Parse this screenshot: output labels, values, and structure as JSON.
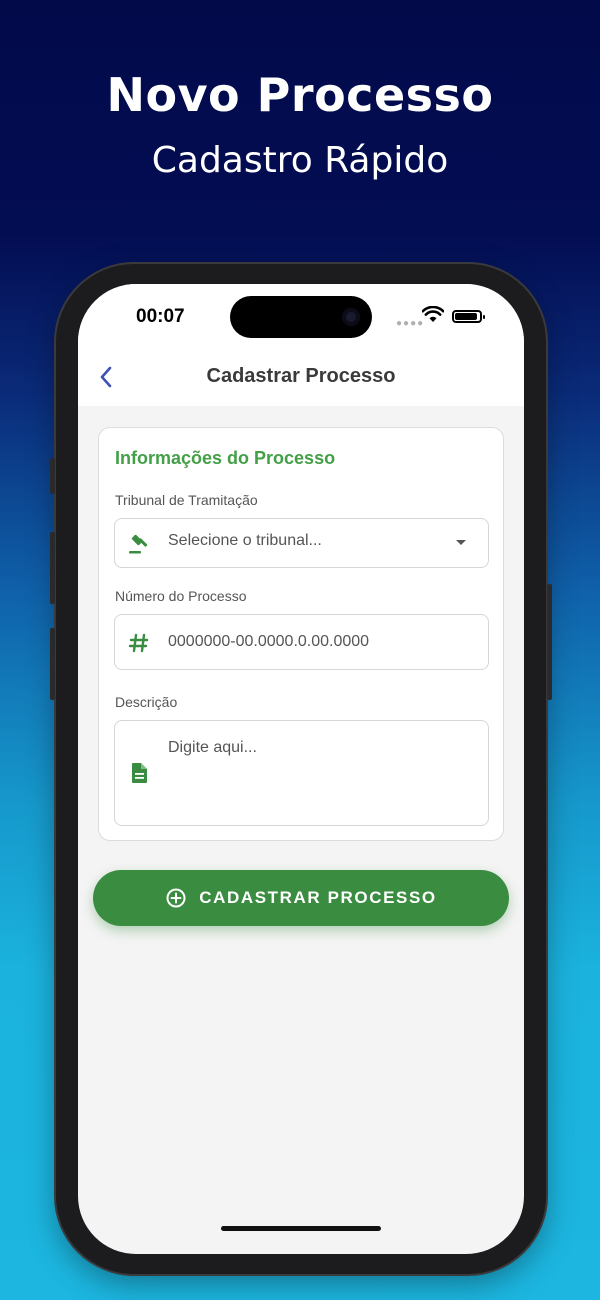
{
  "promo": {
    "title": "Novo Processo",
    "subtitle": "Cadastro Rápido"
  },
  "status_bar": {
    "time": "00:07",
    "icons": [
      "signal-icon",
      "wifi-icon",
      "battery-icon"
    ]
  },
  "navbar": {
    "back_icon": "chevron-left-icon",
    "title": "Cadastrar Processo"
  },
  "form": {
    "section_title": "Informações do Processo",
    "tribunal": {
      "label": "Tribunal de Tramitação",
      "icon": "gavel-icon",
      "placeholder": "Selecione o tribunal...",
      "arrow_icon": "dropdown-arrow-icon"
    },
    "numero": {
      "label": "Número do Processo",
      "icon": "hash-icon",
      "placeholder": "0000000-00.0000.0.00.0000"
    },
    "descricao": {
      "label": "Descrição",
      "icon": "document-icon",
      "placeholder": "Digite aqui..."
    }
  },
  "submit_button": {
    "icon": "add-circle-icon",
    "label": "CADASTRAR PROCESSO"
  },
  "colors": {
    "accent_green": "#43a047",
    "button_green": "#3a8c40",
    "nav_blue": "#3f51b5",
    "background_top": "#020a4a",
    "background_bottom": "#1cb6e0"
  }
}
